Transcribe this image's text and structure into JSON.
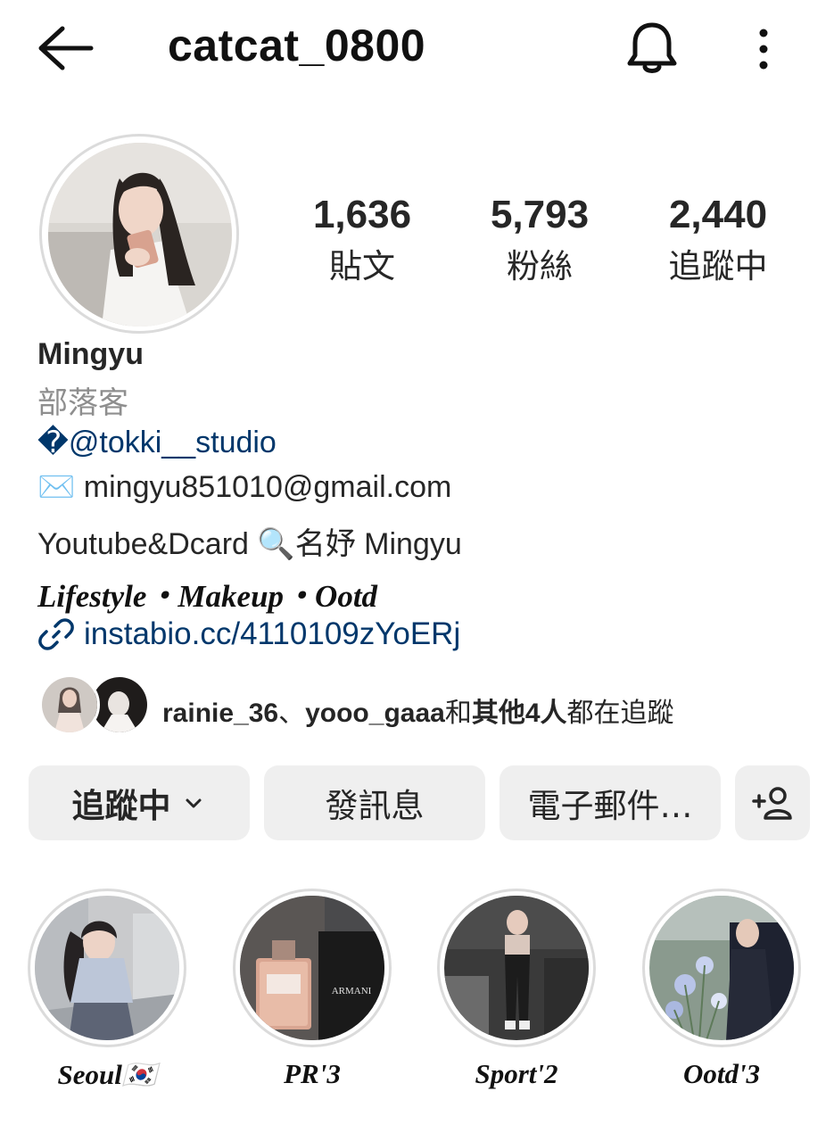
{
  "header": {
    "username": "catcat_0800",
    "back_icon": "arrow-left-icon",
    "notification_icon": "bell-icon",
    "more_icon": "more-vertical-icon"
  },
  "stats": [
    {
      "value": "1,636",
      "label": "貼文"
    },
    {
      "value": "5,793",
      "label": "粉絲"
    },
    {
      "value": "2,440",
      "label": "追蹤中"
    }
  ],
  "bio": {
    "name": "Mingyu",
    "category": "部落客",
    "mention_prefix": "�",
    "mention": "@tokki__studio",
    "email_emoji": "✉️",
    "email": "mingyu851010@gmail.com",
    "line3": "Youtube&Dcard 🔍名妤 Mingyu",
    "tagline": "Lifestyle・Makeup・Ootd",
    "link": "instabio.cc/4110109zYoERj"
  },
  "followed_by": {
    "user1": "rainie_36",
    "separator": "、",
    "user2": "yooo_gaaa",
    "and": "和",
    "others": "其他4人",
    "suffix": "都在追蹤"
  },
  "actions": {
    "following_label": "追蹤中",
    "message_label": "發訊息",
    "email_label": "電子郵件…",
    "add_user_icon": "add-person-icon"
  },
  "highlights": [
    {
      "label": "Seoul🇰🇷"
    },
    {
      "label": "PR'3"
    },
    {
      "label": "Sport'2"
    },
    {
      "label": "Ootd'3"
    }
  ],
  "colors": {
    "link": "#00376b",
    "secondary_text": "#8e8e8e",
    "button_bg": "#efefef",
    "ring": "#dbdbdb"
  }
}
